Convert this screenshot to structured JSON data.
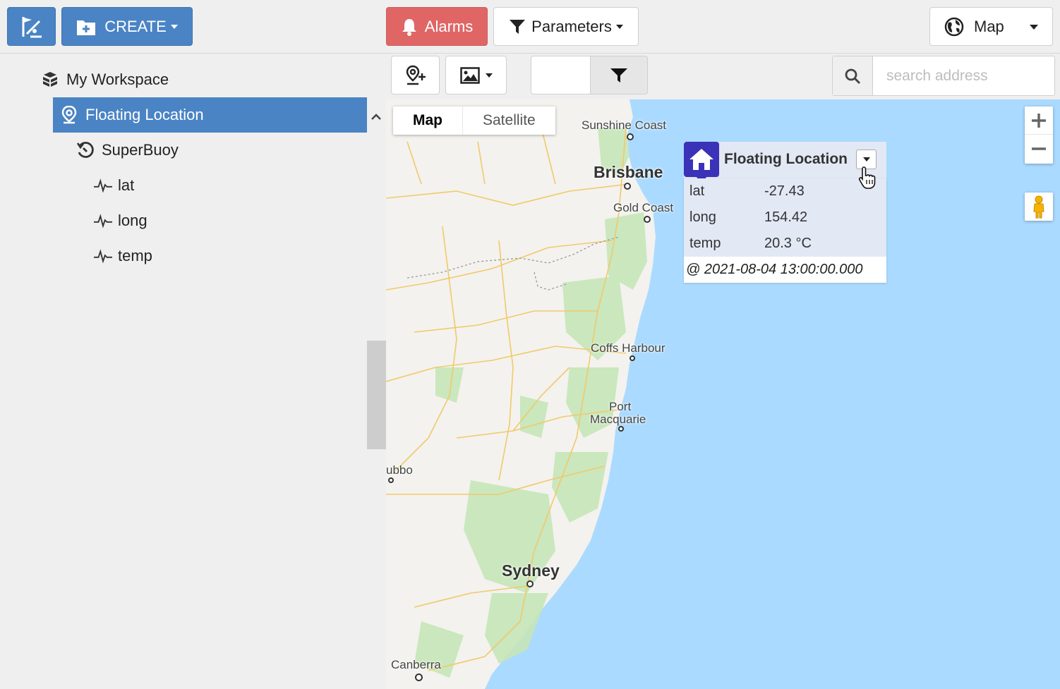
{
  "toolbar": {
    "tool_icon": "ruler-flag-icon",
    "create_label": "CREATE",
    "alarms_label": "Alarms",
    "parameters_label": "Parameters",
    "view_label": "Map"
  },
  "tree": {
    "workspace_label": "My Workspace",
    "items": [
      {
        "label": "Floating Location",
        "icon": "map-pin-icon",
        "selected": true
      },
      {
        "label": "SuperBuoy",
        "icon": "history-icon"
      },
      {
        "label": "lat",
        "icon": "pulse-icon"
      },
      {
        "label": "long",
        "icon": "pulse-icon"
      },
      {
        "label": "temp",
        "icon": "pulse-icon"
      }
    ]
  },
  "map_toolbar": {
    "search_placeholder": "search address"
  },
  "map": {
    "type_map": "Map",
    "type_satellite": "Satellite",
    "cities": {
      "sunshine_coast": "Sunshine Coast",
      "brisbane": "Brisbane",
      "gold_coast": "Gold Coast",
      "coffs_harbour": "Coffs Harbour",
      "port": "Port",
      "macquarie": "Macquarie",
      "dubbo": "ubbo",
      "sydney": "Sydney",
      "canberra": "Canberra"
    },
    "colors": {
      "land": "#f3f2ee",
      "water": "#aadaff",
      "forest": "#c6e6b8",
      "roads": "#f2c96b"
    }
  },
  "popup": {
    "title": "Floating Location",
    "rows": [
      {
        "key": "lat",
        "value": "-27.43"
      },
      {
        "key": "long",
        "value": "154.42"
      },
      {
        "key": "temp",
        "value": "20.3 °C"
      }
    ],
    "timestamp": "@ 2021-08-04 13:00:00.000"
  },
  "colors": {
    "primary": "#4a84c4",
    "alarm": "#e06666",
    "marker": "#3a32b7"
  }
}
